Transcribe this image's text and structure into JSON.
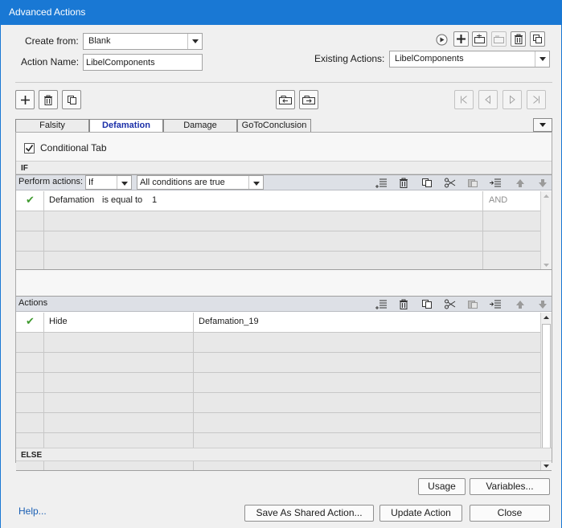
{
  "window": {
    "title": "Advanced Actions"
  },
  "form": {
    "create_from_label": "Create from:",
    "create_from_value": "Blank",
    "action_name_label": "Action Name:",
    "action_name_value": "LibelComponents",
    "existing_actions_label": "Existing Actions:",
    "existing_actions_value": "LibelComponents"
  },
  "tabs": [
    {
      "label": "Falsity",
      "active": false
    },
    {
      "label": "Defamation",
      "active": true
    },
    {
      "label": "Damage",
      "active": false
    },
    {
      "label": "GoToConclusion",
      "active": false
    }
  ],
  "panel": {
    "conditional_tab_label": "Conditional Tab",
    "conditional_tab_checked": true,
    "if_label": "IF",
    "else_label": "ELSE",
    "perform_actions_label": "Perform actions:",
    "perform_actions_value": "If",
    "conditions_value": "All conditions are true",
    "actions_label": "Actions"
  },
  "conditions": [
    {
      "variable": "Defamation",
      "operator": "is equal to",
      "value": "1",
      "logic": "AND"
    }
  ],
  "actions": [
    {
      "command": "Hide",
      "target": "Defamation_19"
    }
  ],
  "buttons": {
    "usage": "Usage",
    "variables": "Variables...",
    "help": "Help...",
    "save_shared": "Save As Shared Action...",
    "update": "Update Action",
    "close": "Close"
  },
  "colors": {
    "title_bar": "#1978d4",
    "active_tab_text": "#1b2fa8",
    "check_green": "#3f9a2f",
    "help_link": "#1a5fb4"
  }
}
